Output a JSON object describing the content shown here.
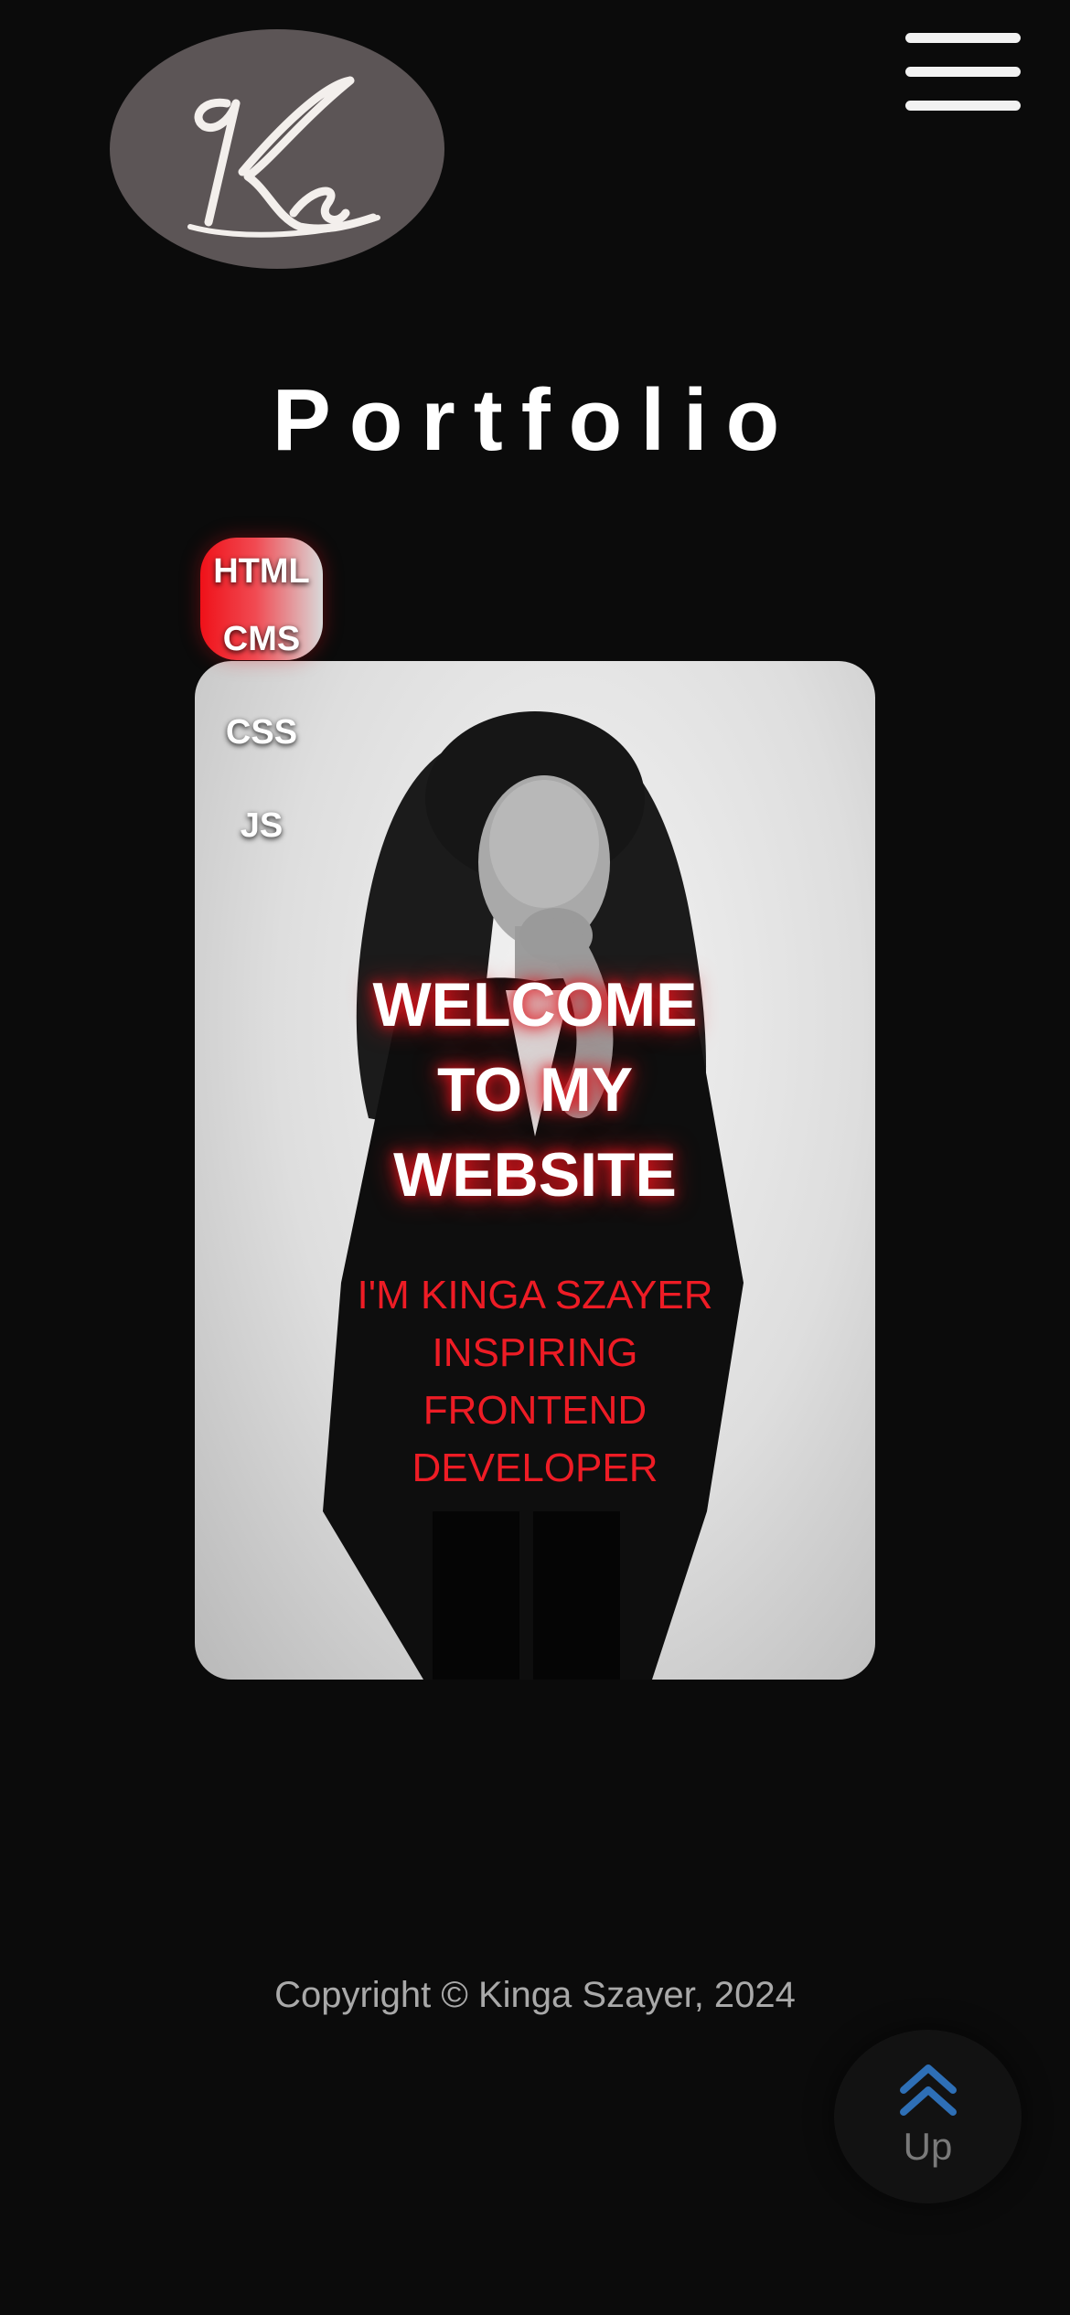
{
  "header": {
    "logo_text": "Ks",
    "menu_icon": "hamburger-menu-icon"
  },
  "main": {
    "title": "Portfolio",
    "tabs": [
      {
        "label": "HTML",
        "active": true
      },
      {
        "label": "CMS",
        "active": false
      },
      {
        "label": "CSS",
        "active": false
      },
      {
        "label": "JS",
        "active": false
      }
    ],
    "hero": {
      "welcome_lines": [
        "WELCOME",
        "TO MY",
        "WEBSITE"
      ],
      "subtitle_lines": [
        "I'M KINGA SZAYER",
        "INSPIRING",
        "FRONTEND",
        "DEVELOPER"
      ]
    }
  },
  "footer": {
    "copyright": "Copyright © Kinga Szayer, 2024",
    "up_label": "Up",
    "up_icon": "double-chevron-up-icon"
  },
  "colors": {
    "background": "#0b0b0b",
    "accent_red": "#ee1c25",
    "logo_bg": "#5c5556",
    "up_icon_blue": "#2e6fb6"
  }
}
